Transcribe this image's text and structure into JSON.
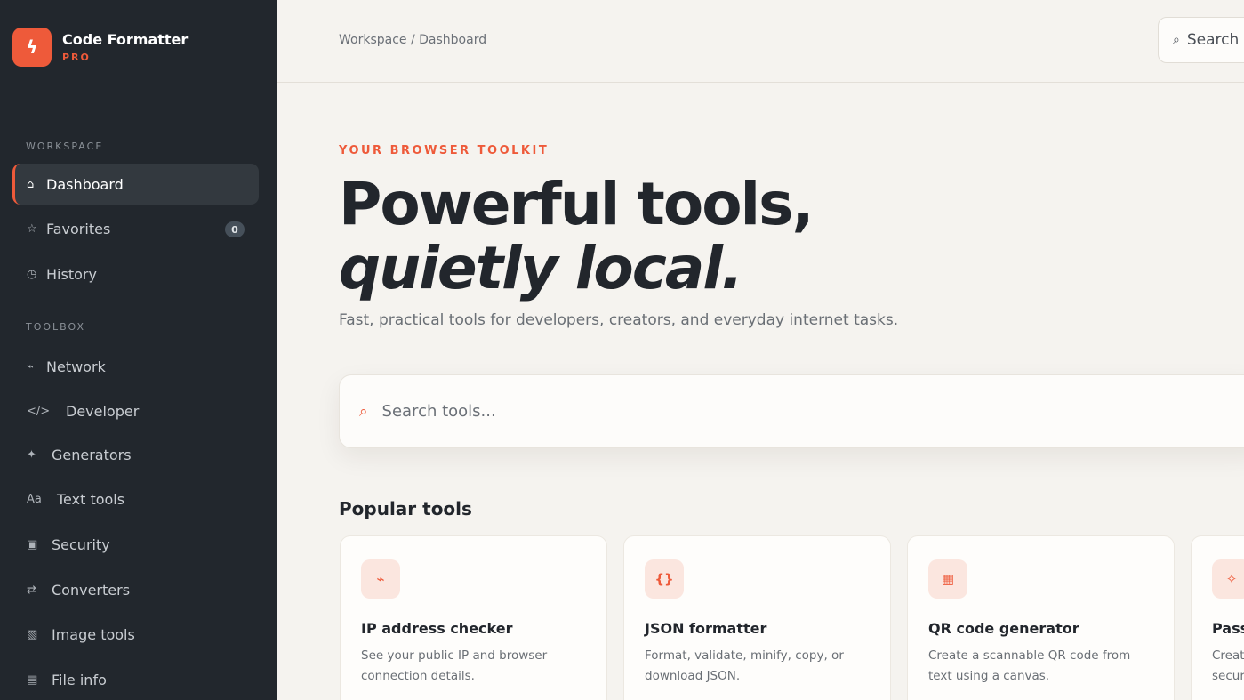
{
  "brand": {
    "name": "Code Formatter",
    "tier": "PRO",
    "logo_icon": "bolt-icon",
    "accent_color": "#ee5a3a"
  },
  "sidebar": {
    "sections": [
      {
        "label": "WORKSPACE",
        "items": [
          {
            "label": "Dashboard",
            "icon": "⌂",
            "active": true
          },
          {
            "label": "Favorites",
            "icon": "☆",
            "badge": "0"
          },
          {
            "label": "History",
            "icon": "◷"
          }
        ]
      },
      {
        "label": "TOOLBOX",
        "items": [
          {
            "label": "Network",
            "icon": "⌁"
          },
          {
            "label": "Developer",
            "icon": "</>"
          },
          {
            "label": "Generators",
            "icon": "✦"
          },
          {
            "label": "Text tools",
            "icon": "Aa"
          },
          {
            "label": "Security",
            "icon": "▣"
          },
          {
            "label": "Converters",
            "icon": "⇄"
          },
          {
            "label": "Image tools",
            "icon": "▧"
          },
          {
            "label": "File info",
            "icon": "▤"
          }
        ]
      }
    ]
  },
  "topbar": {
    "breadcrumb": "Workspace / Dashboard",
    "search_label": "Search",
    "search_icon": "⌕"
  },
  "hero": {
    "eyebrow": "YOUR BROWSER TOOLKIT",
    "title_line1": "Powerful tools,",
    "title_line2": "quietly local.",
    "subtitle": "Fast, practical tools for developers, creators, and everyday internet tasks."
  },
  "search": {
    "placeholder": "Search tools...",
    "icon": "⌕"
  },
  "popular": {
    "heading": "Popular tools",
    "cards": [
      {
        "icon": "⌁",
        "title": "IP address checker",
        "desc": "See your public IP and browser connection details."
      },
      {
        "icon": "{}",
        "title": "JSON formatter",
        "desc": "Format, validate, minify, copy, or download JSON."
      },
      {
        "icon": "▦",
        "title": "QR code generator",
        "desc": "Create a scannable QR code from text using a canvas."
      },
      {
        "icon": "✧",
        "title": "Pass",
        "desc": "Creat secur"
      }
    ]
  }
}
